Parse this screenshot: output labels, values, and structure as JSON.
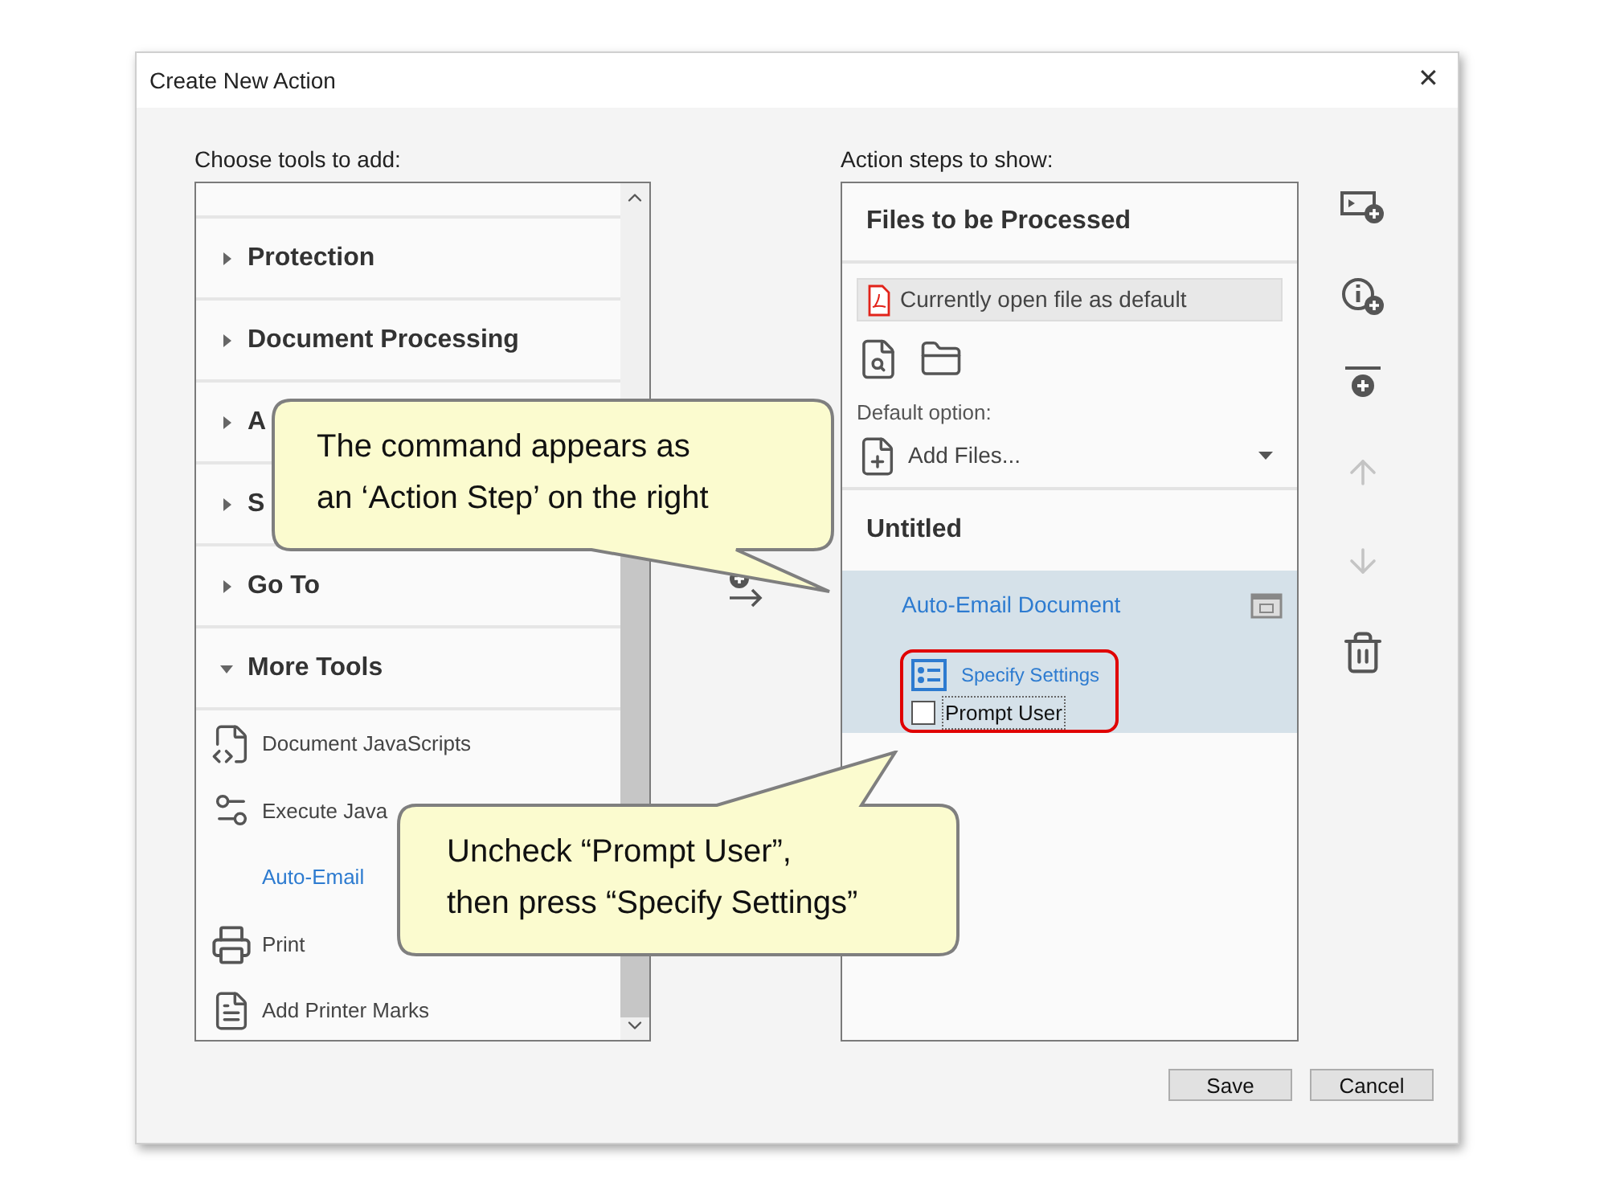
{
  "window": {
    "title": "Create New Action",
    "close_glyph": "✕"
  },
  "tools_panel": {
    "label": "Choose tools to add:",
    "groups": [
      {
        "label": "Protection",
        "expanded": false
      },
      {
        "label": "Document Processing",
        "expanded": false
      },
      {
        "label": "A",
        "expanded": false
      },
      {
        "label": "S",
        "expanded": false
      },
      {
        "label": "Go To",
        "expanded": false
      },
      {
        "label": "More Tools",
        "expanded": true,
        "children": [
          {
            "label": "Document JavaScripts",
            "highlighted": false
          },
          {
            "label": "Execute Java",
            "highlighted": false
          },
          {
            "label": "Auto-Email",
            "highlighted": true
          },
          {
            "label": "Print",
            "highlighted": false
          },
          {
            "label": "Add Printer Marks",
            "highlighted": false
          }
        ]
      }
    ]
  },
  "steps_panel": {
    "label": "Action steps to show:",
    "files_section": {
      "title": "Files to be Processed",
      "current_file": "Currently open file as default",
      "default_option_label": "Default option:",
      "default_option": "Add Files..."
    },
    "steps_section": {
      "title": "Untitled",
      "steps": [
        {
          "label": "Auto-Email Document",
          "selected": true,
          "settings_button": "Specify Settings",
          "prompt_user": {
            "label": "Prompt User",
            "checked": false
          }
        }
      ]
    }
  },
  "side_tools": [
    {
      "kind": "insert-menu-item",
      "disabled": false
    },
    {
      "kind": "insert-instruction",
      "disabled": false
    },
    {
      "kind": "insert-separator",
      "disabled": false
    },
    {
      "kind": "move-up",
      "disabled": true
    },
    {
      "kind": "move-down",
      "disabled": true
    },
    {
      "kind": "delete",
      "disabled": false
    }
  ],
  "buttons": [
    "Save",
    "Cancel"
  ],
  "callouts": [
    {
      "lines": [
        "The command appears as",
        "an ‘Action Step’ on the right"
      ]
    },
    {
      "lines": [
        "Uncheck “Prompt User”,",
        "then press “Specify Settings”"
      ]
    }
  ]
}
